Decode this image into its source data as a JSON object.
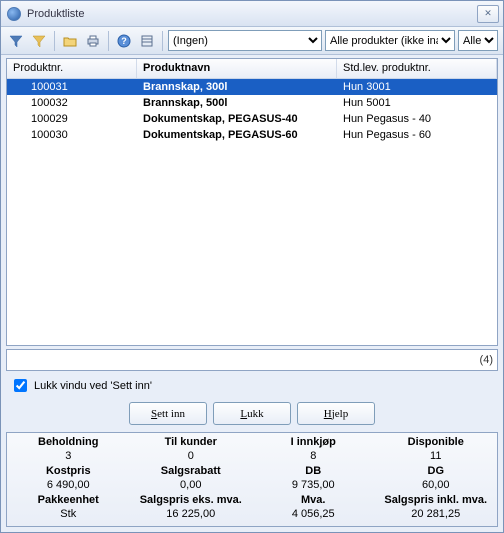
{
  "window": {
    "title": "Produktliste"
  },
  "toolbar": {
    "dropdown1": "(Ingen)",
    "dropdown2": "Alle produkter (ikke inaktive)",
    "dropdown3": "Alle"
  },
  "grid": {
    "headers": [
      "Produktnr.",
      "Produktnavn",
      "Std.lev. produktnr."
    ],
    "rows": [
      {
        "nr": "100031",
        "navn": "Brannskap, 300l",
        "std": "Hun 3001",
        "selected": true
      },
      {
        "nr": "100032",
        "navn": "Brannskap, 500l",
        "std": "Hun 5001",
        "selected": false
      },
      {
        "nr": "100029",
        "navn": "Dokumentskap, PEGASUS-40",
        "std": "Hun Pegasus - 40",
        "selected": false
      },
      {
        "nr": "100030",
        "navn": "Dokumentskap, PEGASUS-60",
        "std": "Hun Pegasus - 60",
        "selected": false
      }
    ]
  },
  "search": {
    "value": "",
    "count": "(4)"
  },
  "checkbox": {
    "label": "Lukk vindu ved 'Sett inn'"
  },
  "buttons": {
    "sett_inn": "Sett inn",
    "lukk": "Lukk",
    "hjelp": "Hjelp"
  },
  "details": [
    [
      {
        "label": "Beholdning",
        "value": "3"
      },
      {
        "label": "Til kunder",
        "value": "0"
      },
      {
        "label": "I innkjøp",
        "value": "8"
      },
      {
        "label": "Disponible",
        "value": "11"
      }
    ],
    [
      {
        "label": "Kostpris",
        "value": "6 490,00"
      },
      {
        "label": "Salgsrabatt",
        "value": "0,00"
      },
      {
        "label": "DB",
        "value": "9 735,00"
      },
      {
        "label": "DG",
        "value": "60,00"
      }
    ],
    [
      {
        "label": "Pakkeenhet",
        "value": "Stk"
      },
      {
        "label": "Salgspris eks. mva.",
        "value": "16 225,00"
      },
      {
        "label": "Mva.",
        "value": "4 056,25"
      },
      {
        "label": "Salgspris inkl. mva.",
        "value": "20 281,25"
      }
    ]
  ]
}
